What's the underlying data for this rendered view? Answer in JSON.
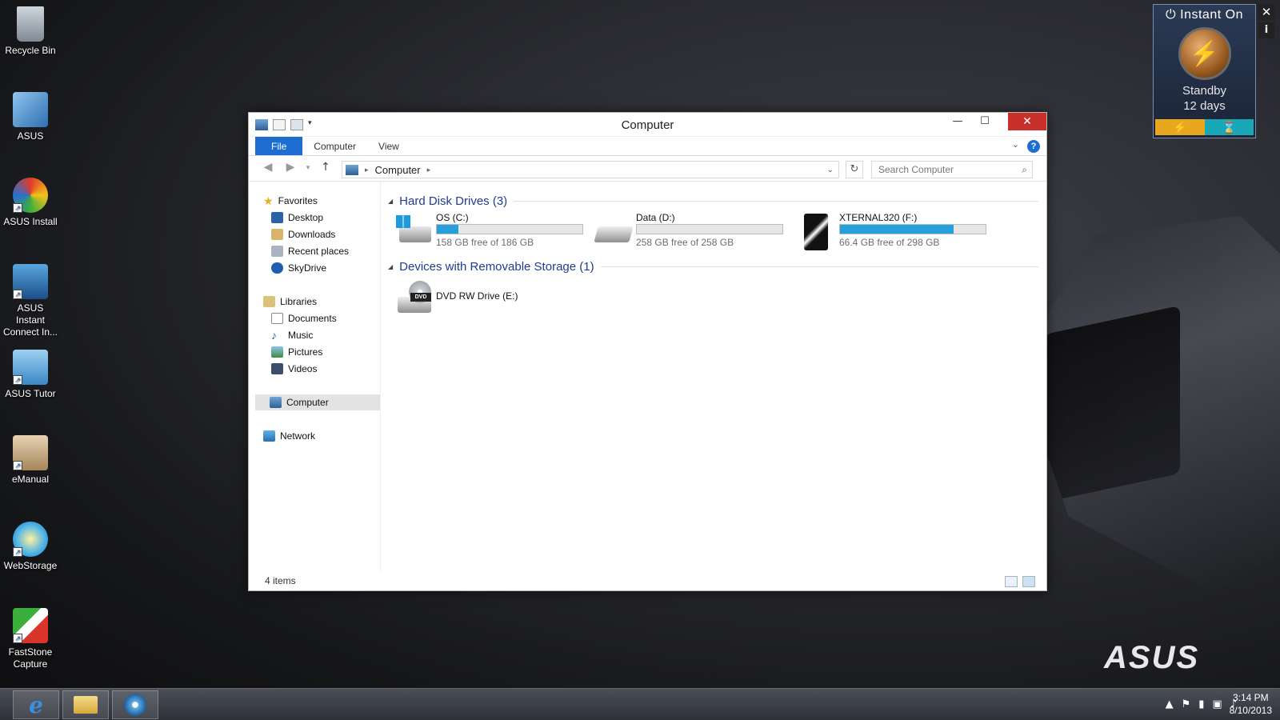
{
  "desktop_icons": [
    {
      "label": "Recycle Bin",
      "icon": "recycle-bin-icon",
      "color": "#9aa3ad"
    },
    {
      "label": "ASUS",
      "icon": "asus-folder-icon",
      "color": "#3d7fc1"
    },
    {
      "label": "ASUS Install",
      "icon": "asus-install-icon",
      "color": "#e0a020"
    },
    {
      "label": "ASUS Instant Connect In...",
      "icon": "instant-connect-icon",
      "color": "#2d6ea8"
    },
    {
      "label": "ASUS Tutor",
      "icon": "asus-tutor-icon",
      "color": "#4aa3df"
    },
    {
      "label": "eManual",
      "icon": "emanual-icon",
      "color": "#c9a97a"
    },
    {
      "label": "WebStorage",
      "icon": "webstorage-icon",
      "color": "#48b0e8"
    },
    {
      "label": "FastStone Capture",
      "icon": "faststone-icon",
      "color": "#d8342a"
    }
  ],
  "gadget": {
    "title": "Instant On",
    "state": "Standby",
    "duration": "12 days",
    "colors": {
      "bolt": "#e8a81e",
      "timer": "#18a8b8"
    }
  },
  "wallpaper": {
    "brand": "ASUS"
  },
  "window": {
    "title": "Computer",
    "ribbon_tabs": [
      "File",
      "Computer",
      "View"
    ],
    "breadcrumb": [
      "Computer"
    ],
    "search_placeholder": "Search Computer",
    "nav": {
      "favorites": {
        "label": "Favorites",
        "items": [
          "Desktop",
          "Downloads",
          "Recent places",
          "SkyDrive"
        ]
      },
      "libraries": {
        "label": "Libraries",
        "items": [
          "Documents",
          "Music",
          "Pictures",
          "Videos"
        ]
      },
      "computer": "Computer",
      "network": "Network"
    },
    "groups": {
      "hdd": {
        "label": "Hard Disk Drives (3)",
        "drives": [
          {
            "name": "OS (C:)",
            "free": "158 GB free of 186 GB",
            "used_fraction": 0.15
          },
          {
            "name": "Data (D:)",
            "free": "258 GB free of 258 GB",
            "used_fraction": 0.0
          },
          {
            "name": "XTERNAL320 (F:)",
            "free": "66.4 GB free of 298 GB",
            "used_fraction": 0.78
          }
        ]
      },
      "removable": {
        "label": "Devices with Removable Storage (1)",
        "drives": [
          {
            "name": "DVD RW Drive (E:)"
          }
        ]
      }
    },
    "status": "4 items"
  },
  "taskbar": {
    "pinned": [
      "internet-explorer-icon",
      "file-explorer-icon",
      "app-icon"
    ],
    "time": "3:14 PM",
    "date": "8/10/2013"
  }
}
